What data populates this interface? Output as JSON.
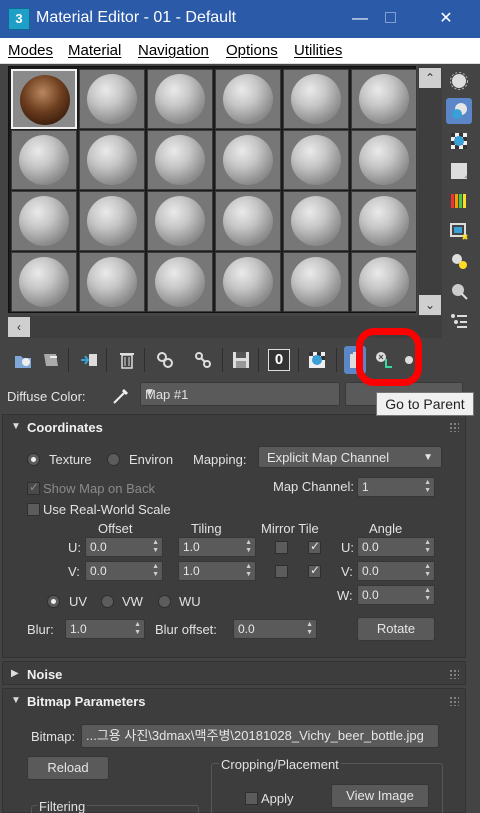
{
  "window": {
    "title": "Material Editor - 01 - Default",
    "app_icon": "3"
  },
  "menu": [
    {
      "label": "Modes"
    },
    {
      "label": "Material"
    },
    {
      "label": "Navigation"
    },
    {
      "label": "Options"
    },
    {
      "label": "Utilities"
    }
  ],
  "diffuse": {
    "label": "Diffuse Color:",
    "map_name": "Map #1"
  },
  "tooltip": "Go to Parent",
  "toolbar": {
    "icons": [
      "get-material-icon",
      "put-to-scene-icon",
      "assign-to-selection-icon",
      "delete-icon",
      "make-unique-icon",
      "put-to-library-icon",
      "save-icon",
      "material-id-channel-icon",
      "show-shaded-icon",
      "show-end-result-icon",
      "go-to-parent-icon",
      "go-forward-to-sibling-icon"
    ],
    "material_id": "0"
  },
  "side_toolbar": [
    "sample-type-icon",
    "backlight-icon",
    "background-icon",
    "sample-uv-tiling-icon",
    "video-color-check-icon",
    "make-preview-icon",
    "options-icon",
    "select-by-material-icon",
    "material-map-navigator-icon"
  ],
  "coordinates": {
    "title": "Coordinates",
    "texture_label": "Texture",
    "environ_label": "Environ",
    "mapping_label": "Mapping:",
    "mapping_value": "Explicit Map Channel",
    "show_map_on_back": "Show Map on Back",
    "map_channel_label": "Map Channel:",
    "map_channel_value": "1",
    "real_world_scale": "Use Real-World Scale",
    "col_offset": "Offset",
    "col_tiling": "Tiling",
    "col_mirror_tile": "Mirror Tile",
    "col_angle": "Angle",
    "u_label": "U:",
    "v_label": "V:",
    "w_label": "W:",
    "u_offset": "0.0",
    "v_offset": "0.0",
    "u_tiling": "1.0",
    "v_tiling": "1.0",
    "u_angle": "0.0",
    "v_angle": "0.0",
    "w_angle": "0.0",
    "uv_label": "UV",
    "vw_label": "VW",
    "wu_label": "WU",
    "blur_label": "Blur:",
    "blur_value": "1.0",
    "blur_offset_label": "Blur offset:",
    "blur_offset_value": "0.0",
    "rotate_label": "Rotate"
  },
  "noise": {
    "title": "Noise"
  },
  "bitmap": {
    "title": "Bitmap Parameters",
    "bitmap_label": "Bitmap:",
    "bitmap_path": "...그용 사진\\3dmax\\맥주병\\20181028_Vichy_beer_bottle.jpg",
    "reload_label": "Reload",
    "cropping_label": "Cropping/Placement",
    "apply_label": "Apply",
    "view_image_label": "View Image",
    "filtering_label": "Filtering"
  },
  "colors": {
    "accent": "#2b5aa8",
    "highlight": "#ff0000",
    "panel": "#444444"
  }
}
